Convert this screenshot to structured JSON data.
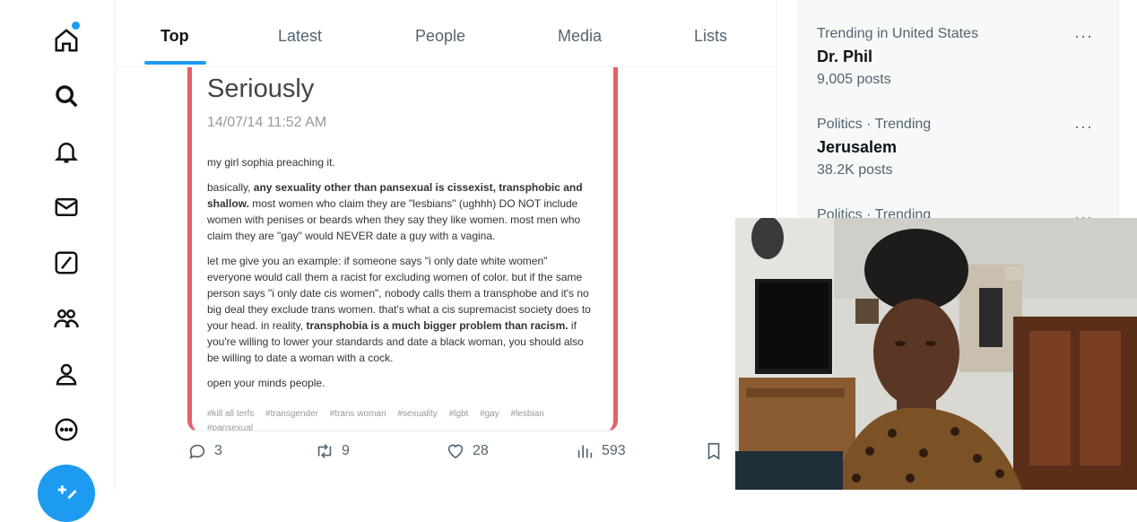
{
  "nav": {
    "items": [
      "home-icon",
      "search-icon",
      "bell-icon",
      "mail-icon",
      "grok-icon",
      "communities-icon",
      "profile-icon",
      "more-icon"
    ],
    "accent": "#1d9bf0"
  },
  "tabs": [
    {
      "label": "Top",
      "active": true
    },
    {
      "label": "Latest",
      "active": false
    },
    {
      "label": "People",
      "active": false
    },
    {
      "label": "Media",
      "active": false
    },
    {
      "label": "Lists",
      "active": false
    }
  ],
  "post": {
    "title": "Seriously",
    "date": "14/07/14 11:52 AM",
    "p1": "my girl sophia preaching it.",
    "p2_a": "basically, ",
    "p2_bold": "any sexuality other than pansexual is cissexist, transphobic and shallow.",
    "p2_b": " most women who claim they are \"lesbians\" (ughhh) DO NOT include women with penises or beards when they say they like women. most men who claim they are \"gay\" would NEVER date a guy with a vagina.",
    "p3_a": "let me give you an example: if someone says \"i only date white women\" everyone would call them a racist for excluding women of color. but if the same person says \"i only date cis women\", nobody calls them a transphobe and it's no big deal they exclude trans women. that's what a cis supremacist society does to your head. in reality, ",
    "p3_bold": "transphobia is a much bigger problem than racism.",
    "p3_b": " if you're willing to lower your standards and date a black woman, you should also be willing to date a woman with a cock.",
    "p4": "open your minds people.",
    "tags": [
      "#kill all terfs",
      "#transgender",
      "#trans woman",
      "#sexuality",
      "#lgbt",
      "#gay",
      "#lesbian",
      "#pansexual"
    ],
    "border_color": "#e4606c"
  },
  "actions": {
    "replies": "3",
    "reposts": "9",
    "likes": "28",
    "views": "593"
  },
  "trends": [
    {
      "meta": "Trending in United States",
      "name": "Dr. Phil",
      "count": "9,005 posts"
    },
    {
      "meta": "Politics · Trending",
      "name": "Jerusalem",
      "count": "38.2K posts"
    },
    {
      "meta": "Politics · Trending",
      "name": "",
      "count": ""
    }
  ],
  "more_label": "···"
}
